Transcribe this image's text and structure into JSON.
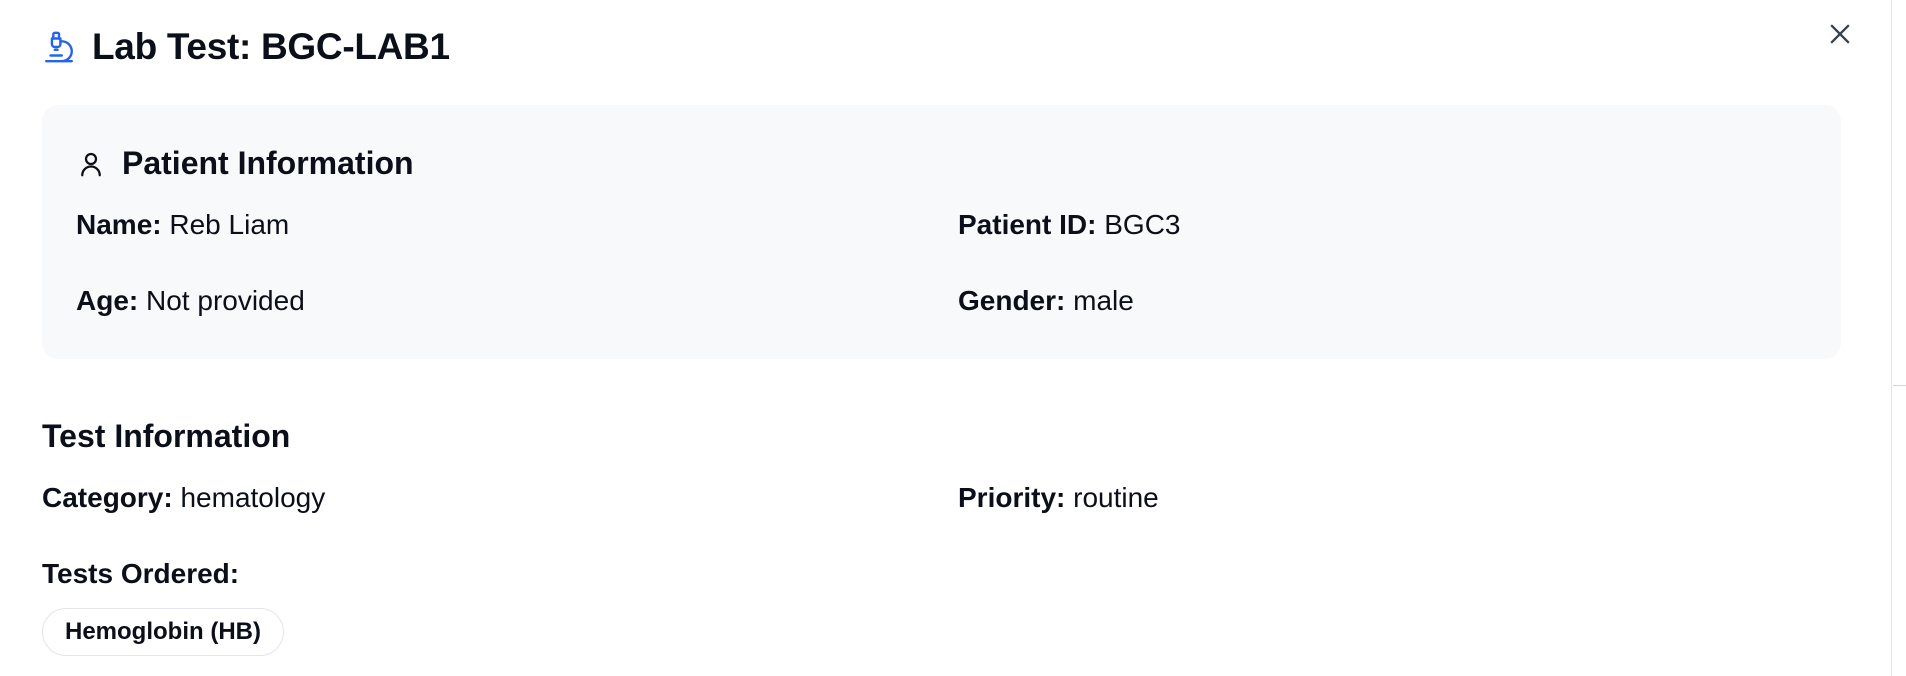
{
  "modal": {
    "title": "Lab Test: BGC-LAB1",
    "title_icon": "microscope-icon",
    "close_icon": "close-icon"
  },
  "patient": {
    "heading": "Patient Information",
    "heading_icon": "user-icon",
    "name_label": "Name:",
    "name_value": "Reb Liam",
    "id_label": "Patient ID:",
    "id_value": "BGC3",
    "age_label": "Age:",
    "age_value": "Not provided",
    "gender_label": "Gender:",
    "gender_value": "male"
  },
  "test": {
    "heading": "Test Information",
    "category_label": "Category:",
    "category_value": "hematology",
    "priority_label": "Priority:",
    "priority_value": "routine",
    "tests_ordered_label": "Tests Ordered:",
    "tests_ordered": [
      "Hemoglobin (HB)"
    ]
  },
  "colors": {
    "accent": "#2563eb",
    "card_background": "#f8f9fb",
    "text": "#0b0f19"
  }
}
